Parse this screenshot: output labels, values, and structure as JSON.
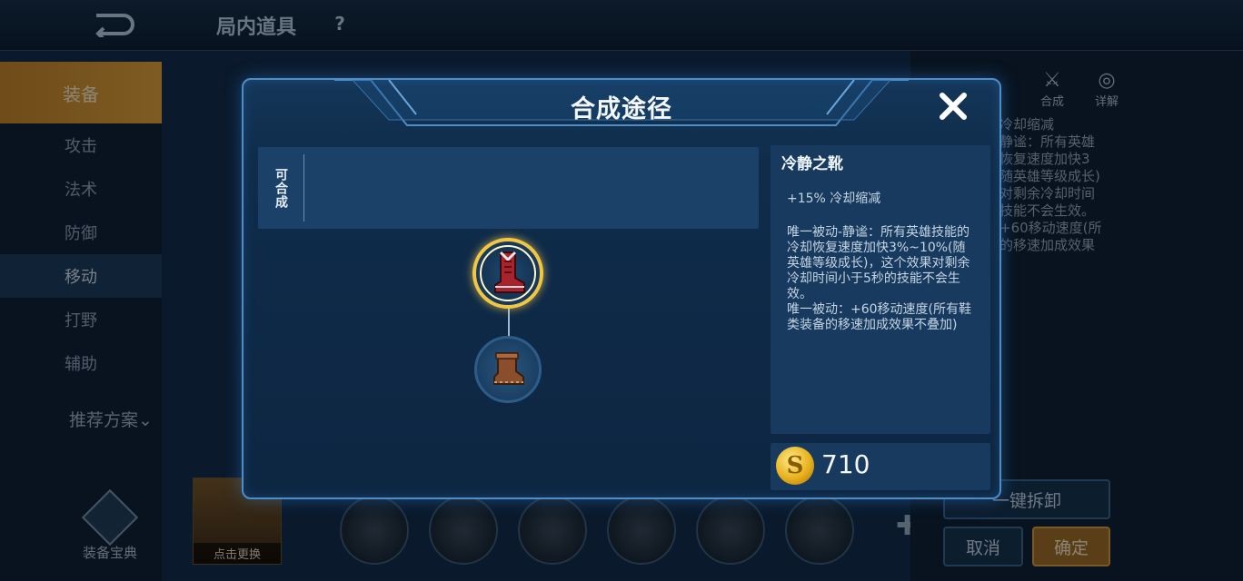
{
  "background": {
    "page_title": "局内道具",
    "help_label": "?",
    "categories": [
      "装备",
      "攻击",
      "法术",
      "防御",
      "移动",
      "打野",
      "辅助"
    ],
    "recommend_label": "推荐方案",
    "codex_label": "装备宝典",
    "hero_card_label": "点击更换",
    "right_icons": [
      {
        "label": "合成",
        "icon": "crossed-swords-icon"
      },
      {
        "label": "详解",
        "icon": "detail-icon"
      }
    ],
    "right_text": "冷却缩减\n静谧：所有英雄\n恢复速度加快3\n随英雄等级成长)\n对剩余冷却时间\n技能不会生效。\n+60移动速度(所\n的移速加成效果",
    "dismantle_label": "一键拆卸",
    "cancel_label": "取消",
    "confirm_label": "确定"
  },
  "modal": {
    "title": "合成途径",
    "craftable_label": "可合成",
    "item": {
      "name": "冷静之靴",
      "stat": "+15% 冷却缩减",
      "description": "唯一被动-静谧：所有英雄技能的冷却恢复速度加快3%~10%(随英雄等级成长)，这个效果对剩余冷却时间小于5秒的技能不会生效。\n唯一被动：+60移动速度(所有鞋类装备的移速加成效果不叠加)",
      "price": "710"
    },
    "tree": {
      "top_item": "boots-red-icon",
      "bottom_item": "boots-brown-icon"
    }
  },
  "colors": {
    "accent_gold": "#f2c640",
    "modal_border": "#4f8dc6",
    "category_active": "#e6a63e"
  }
}
